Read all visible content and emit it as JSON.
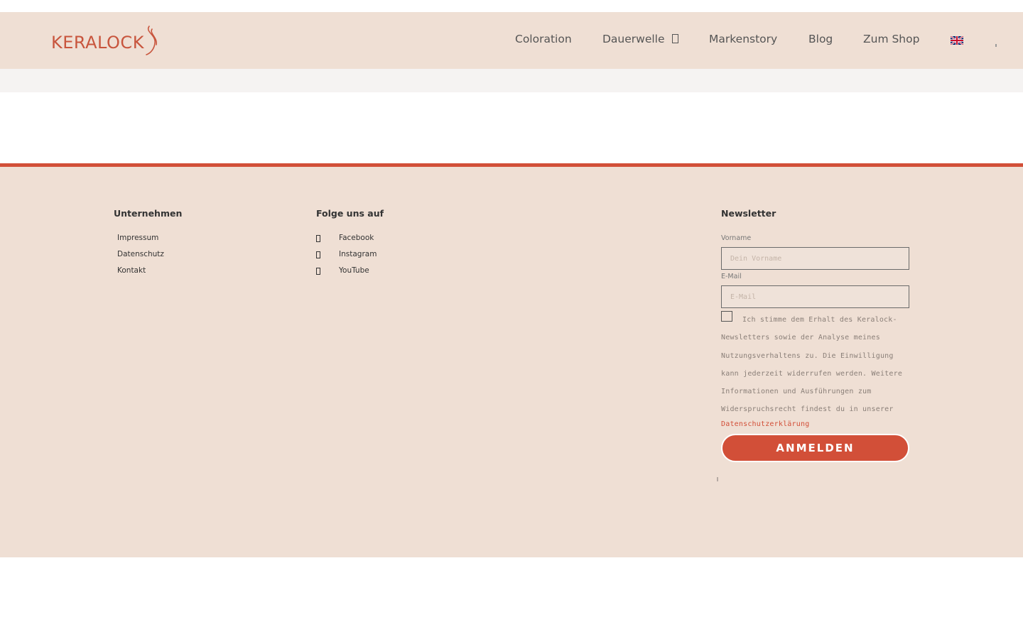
{
  "header": {
    "logo_text": "KERALOCK",
    "nav": [
      {
        "label": "Coloration"
      },
      {
        "label": "Dauerwelle"
      },
      {
        "label": "Markenstory"
      },
      {
        "label": "Blog"
      },
      {
        "label": "Zum Shop"
      }
    ],
    "language_flag_icon": "uk-flag-icon"
  },
  "footer": {
    "company": {
      "title": "Unternehmen",
      "links": [
        "Impressum",
        "Datenschutz",
        "Kontakt"
      ]
    },
    "social": {
      "title": "Folge uns auf",
      "links": [
        {
          "label": "Facebook",
          "icon": "facebook-icon"
        },
        {
          "label": "Instagram",
          "icon": "instagram-icon"
        },
        {
          "label": "YouTube",
          "icon": "youtube-icon"
        }
      ]
    },
    "newsletter": {
      "title": "Newsletter",
      "firstname_label": "Vorname",
      "firstname_placeholder": "Dein Vorname",
      "email_label": "E-Mail",
      "email_placeholder": "E-Mail",
      "consent_lines": [
        "Ich stimme dem Erhalt des Keralock-",
        "Newsletters sowie der Analyse meines",
        "Nutzungsverhaltens zu. Die Einwilligung",
        "kann jederzeit widerrufen werden. Weitere",
        "Informationen und Ausführungen zum",
        "Widerspruchsrecht findest du in unserer"
      ],
      "privacy_link": "Datenschutzerklärung",
      "submit_label": "ANMELDEN"
    }
  },
  "colors": {
    "accent": "#d24f38",
    "background": "#efdfd4"
  }
}
